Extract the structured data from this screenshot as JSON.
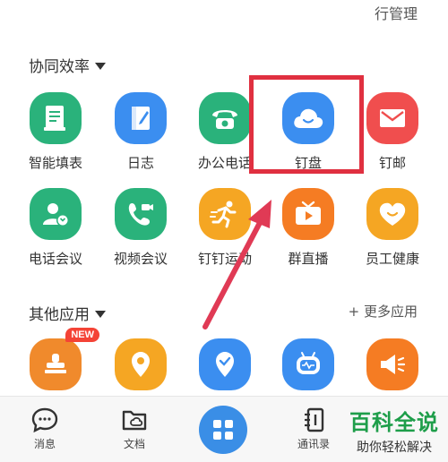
{
  "top_link": "行管理",
  "section1": {
    "title": "协同效率"
  },
  "section2": {
    "title": "其他应用",
    "more": "+ 更多应用"
  },
  "apps_row1": [
    {
      "label": "智能填表",
      "color": "#2ab27b",
      "icon": "form-icon"
    },
    {
      "label": "日志",
      "color": "#3b8ef0",
      "icon": "log-icon"
    },
    {
      "label": "办公电话",
      "color": "#2ab27b",
      "icon": "phone-icon"
    },
    {
      "label": "钉盘",
      "color": "#3b8ef0",
      "icon": "cloud-icon"
    },
    {
      "label": "钉邮",
      "color": "#f04e4e",
      "icon": "mail-icon"
    }
  ],
  "apps_row2": [
    {
      "label": "电话会议",
      "color": "#2ab27b",
      "icon": "conference-call-icon"
    },
    {
      "label": "视频会议",
      "color": "#2ab27b",
      "icon": "video-call-icon"
    },
    {
      "label": "钉钉运动",
      "color": "#f5a623",
      "icon": "run-icon"
    },
    {
      "label": "群直播",
      "color": "#f57c23",
      "icon": "tv-icon"
    },
    {
      "label": "员工健康",
      "color": "#f5a623",
      "icon": "heart-icon"
    }
  ],
  "apps_row3": [
    {
      "color": "#f08a2c",
      "icon": "stamp-icon",
      "badge": "NEW"
    },
    {
      "color": "#f5a623",
      "icon": "location-icon"
    },
    {
      "color": "#3b8ef0",
      "icon": "location-check-icon"
    },
    {
      "color": "#3b8ef0",
      "icon": "robot-icon"
    },
    {
      "color": "#f57c23",
      "icon": "megaphone-icon"
    }
  ],
  "tabbar": {
    "messages": "消息",
    "docs": "文档",
    "contacts": "通讯录"
  },
  "watermark": {
    "title": "百科全说",
    "subtitle": "助你轻松解决"
  },
  "colors": {
    "highlight": "#e03040",
    "arrow": "#e03a55",
    "accent": "#3a8ee6"
  }
}
